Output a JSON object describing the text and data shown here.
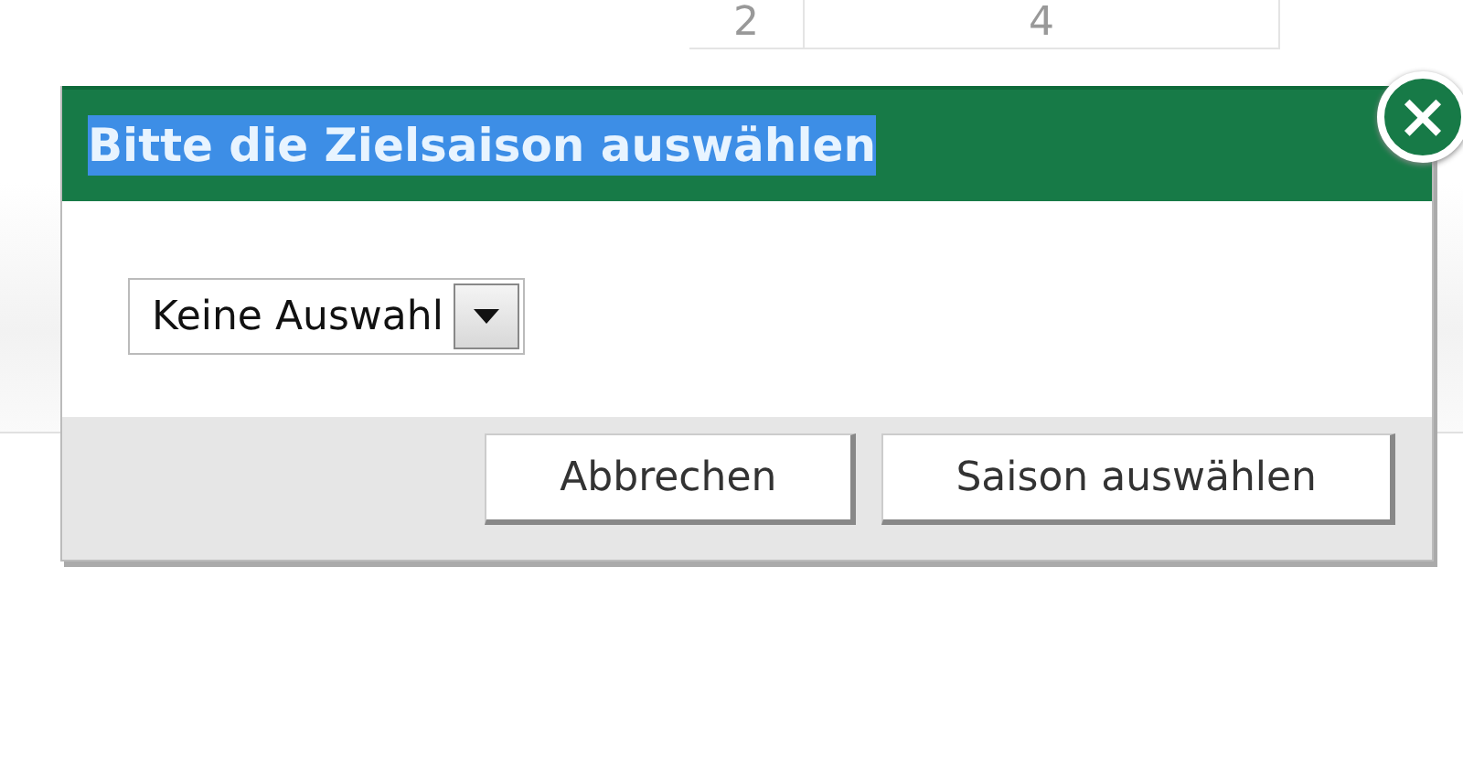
{
  "background_table": {
    "rows": [
      [
        "2",
        "4"
      ]
    ]
  },
  "dialog": {
    "title": "Bitte die Zielsaison auswählen",
    "title_highlighted": true,
    "close_icon": "×",
    "select": {
      "value": "Keine Auswahl"
    },
    "buttons": [
      {
        "label": "Abbrechen"
      },
      {
        "label": "Saison auswählen"
      }
    ]
  }
}
